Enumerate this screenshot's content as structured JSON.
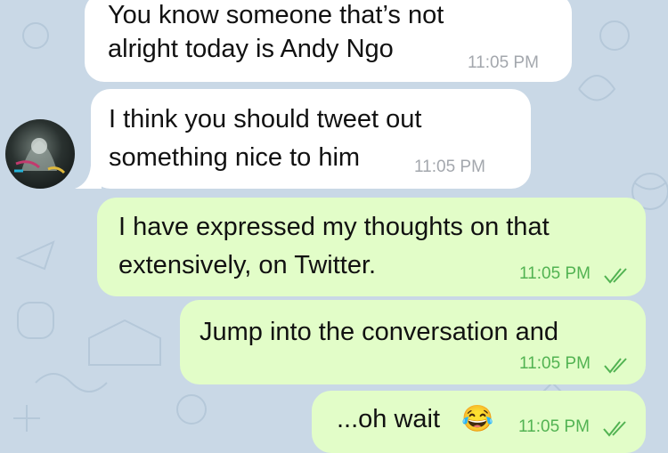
{
  "messages": [
    {
      "direction": "incoming",
      "lines": [
        "You know someone that’s not",
        "alright today is Andy Ngo"
      ],
      "time": "11:05 PM"
    },
    {
      "direction": "incoming",
      "lines": [
        "I think you should tweet out",
        "something nice to him"
      ],
      "time": "11:05 PM"
    },
    {
      "direction": "outgoing",
      "lines": [
        "I have expressed my thoughts on that",
        "extensively, on Twitter."
      ],
      "time": "11:05 PM",
      "status": "read"
    },
    {
      "direction": "outgoing",
      "lines": [
        "Jump into the conversation and"
      ],
      "time": "11:05 PM",
      "status": "read"
    },
    {
      "direction": "outgoing",
      "lines": [
        "...oh wait"
      ],
      "emoji": "😂",
      "time": "11:05 PM",
      "status": "read"
    }
  ],
  "colors": {
    "background": "#c9d8e6",
    "incoming": "#ffffff",
    "outgoing": "#e2fdc8",
    "outgoing_time": "#52b352",
    "incoming_time": "#a3a7ad"
  },
  "icons": {
    "read_receipt": "double-check-icon",
    "avatar": "contact-avatar"
  }
}
